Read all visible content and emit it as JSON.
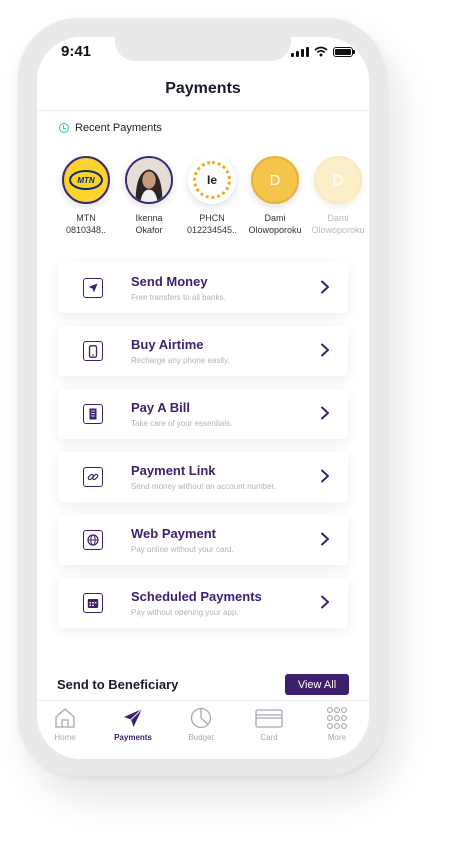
{
  "status_bar": {
    "time": "9:41"
  },
  "header": {
    "title": "Payments"
  },
  "recent": {
    "label": "Recent Payments",
    "items": [
      {
        "name": "MTN",
        "sub": "0810348..",
        "avatar": "MTN"
      },
      {
        "name": "Ikenna",
        "sub": "Okafor",
        "avatar": "photo"
      },
      {
        "name": "PHCN",
        "sub": "012234545..",
        "avatar": "Ie"
      },
      {
        "name": "Dami",
        "sub": "Olowoporoku",
        "avatar": "D"
      },
      {
        "name": "Dami",
        "sub": "Olowoporoku",
        "avatar": "D"
      }
    ]
  },
  "menu": [
    {
      "title": "Send Money",
      "subtitle": "Free transfers to all banks.",
      "icon": "send-icon"
    },
    {
      "title": "Buy Airtime",
      "subtitle": "Recharge any phone easily.",
      "icon": "phone-icon"
    },
    {
      "title": "Pay A Bill",
      "subtitle": "Take care of your essentials.",
      "icon": "bill-icon"
    },
    {
      "title": "Payment Link",
      "subtitle": "Send money without an account number.",
      "icon": "link-icon"
    },
    {
      "title": "Web Payment",
      "subtitle": "Pay online without your card.",
      "icon": "globe-icon"
    },
    {
      "title": "Scheduled Payments",
      "subtitle": "Pay without opening your app.",
      "icon": "calendar-icon"
    }
  ],
  "beneficiary": {
    "title": "Send to Beneficiary",
    "view_all": "View All"
  },
  "tabs": [
    {
      "label": "Home",
      "icon": "home-icon"
    },
    {
      "label": "Payments",
      "icon": "paper-plane-icon",
      "active": true
    },
    {
      "label": "Budget",
      "icon": "pie-chart-icon"
    },
    {
      "label": "Card",
      "icon": "card-icon"
    },
    {
      "label": "More",
      "icon": "grid-icon"
    }
  ],
  "colors": {
    "accent": "#3d1f6d",
    "highlight": "#33c0a0",
    "avatar_yellow": "#f5c64b"
  }
}
